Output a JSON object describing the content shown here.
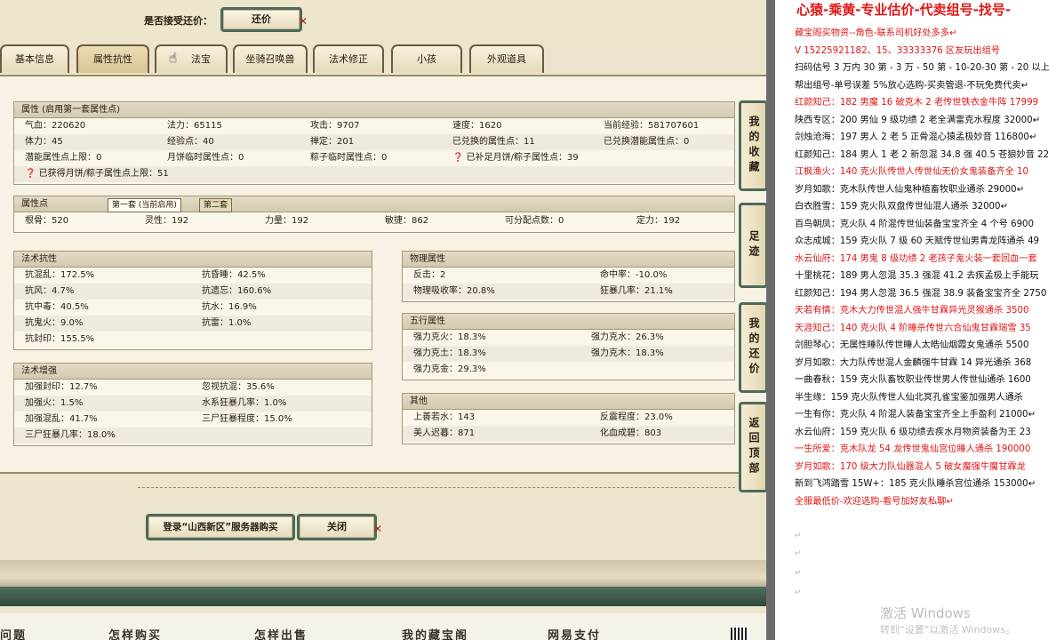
{
  "accept_counter": {
    "label": "是否接受还价：",
    "button": "还价"
  },
  "tabs": [
    "基本信息",
    "属性抗性",
    "法宝",
    "坐骑召唤兽",
    "法术修正",
    "小孩",
    "外观道具"
  ],
  "attr": {
    "header": "属性 (启用第一套属性点)",
    "rows": [
      [
        "气血：220620",
        "法力：65115",
        "攻击：9707",
        "速度：1620",
        "当前经验：581707601"
      ],
      [
        "体力：45",
        "经验点：40",
        "禅定：201",
        "已兑换的属性点：11",
        "已兑换潜能属性点：0"
      ],
      [
        "潜能属性点上限：0",
        "月饼临时属性点：0",
        "粽子临时属性点：0",
        "已补足月饼/粽子属性点：39",
        ""
      ],
      [
        "已获得月饼/粽子属性点上限：51",
        "",
        "",
        "",
        ""
      ]
    ]
  },
  "points": {
    "header": "属性点",
    "set1": "第一套 (当前启用)",
    "set2": "第二套",
    "row": [
      "根骨：520",
      "灵性：192",
      "力量：192",
      "敏捷：862",
      "可分配点数：0",
      "定力：192"
    ]
  },
  "resist": {
    "header": "法术抗性",
    "rows": [
      [
        "抗混乱：172.5%",
        "抗昏睡：42.5%"
      ],
      [
        "抗风：4.7%",
        "抗遗忘：160.6%"
      ],
      [
        "抗中毒：40.5%",
        "抗水：16.9%"
      ],
      [
        "抗鬼火：9.0%",
        "抗雷：1.0%"
      ],
      [
        "抗封印：155.5%",
        ""
      ]
    ]
  },
  "enhance": {
    "header": "法术增强",
    "rows": [
      [
        "加强封印：12.7%",
        "忽视抗混：35.6%"
      ],
      [
        "加强火：1.5%",
        "水系狂暴几率：1.0%"
      ],
      [
        "加强混乱：41.7%",
        "三尸狂暴程度：15.0%"
      ],
      [
        "三尸狂暴几率：18.0%",
        ""
      ]
    ]
  },
  "physical": {
    "header": "物理属性",
    "rows": [
      [
        "反击：2",
        "命中率：-10.0%"
      ],
      [
        "物理吸收率：20.8%",
        "狂暴几率：21.1%"
      ]
    ]
  },
  "elements": {
    "header": "五行属性",
    "rows": [
      [
        "强力克火：18.3%",
        "强力克水：26.3%"
      ],
      [
        "强力克土：18.3%",
        "强力克木：18.3%"
      ],
      [
        "强力克金：29.3%",
        ""
      ]
    ]
  },
  "other": {
    "header": "其他",
    "rows": [
      [
        "上善若水：143",
        "反震程度：23.0%"
      ],
      [
        "美人迟暮：871",
        "化血成碧：803"
      ]
    ]
  },
  "side_buttons": [
    "我的收藏",
    "足迹",
    "我的还价",
    "返回顶部"
  ],
  "bottom_buttons": {
    "buy": "登录“山西新区”服务器购买",
    "close": "关闭"
  },
  "footer_nav": [
    "问题",
    "怎样购买",
    "怎样出售",
    "我的藏宝阁",
    "网易支付"
  ],
  "notes": {
    "title": "心猿-乘黄-专业估价-代卖组号-找号-",
    "lines": [
      {
        "t": "藏宝阁买物资--角色-联系司机好处多多↵",
        "red": true
      },
      {
        "t": "V 15225921182、15、33333376  区友玩出组号",
        "red": true
      },
      {
        "t": "扫码估号 3 万内 30 第 - 3 万 - 50 第 - 10-20-30 第 - 20 以上",
        "red": false
      },
      {
        "t": "帮出组号-单号误差 5%放心选购-买卖管退-不玩免费代卖↵",
        "red": false
      },
      {
        "t": "红颜知己：182 男魔 16 破克木 2 老传世铁衣金牛阵 17999",
        "red": true
      },
      {
        "t": "陕西专区：200 男仙 9 级功绩 2 老全满雷克水程度 32000↵",
        "red": false
      },
      {
        "t": "剑烛沧海：197 男人 2 老 5 正骨混心猿孟极妙音 116800↵",
        "red": false
      },
      {
        "t": "红颜知己：184 男人 1 老 2 新忽混 34.8 强 40.5 苍狼妙音 22",
        "red": false
      },
      {
        "t": "江枫渔火：140 克火队传世人传世仙无价女鬼装备齐全 10",
        "red": true
      },
      {
        "t": "岁月如歌：克木队传世人仙鬼种植畜牧职业通杀 29000↵",
        "red": false
      },
      {
        "t": "白衣胜雪：159 克火队双盘传世仙混人通杀 32000↵",
        "red": false
      },
      {
        "t": "百鸟朝凤：克火队 4 阶混传世仙装备宝宝齐全 4 个号 6900",
        "red": false
      },
      {
        "t": "众志成城：159 克火队 7 级 60 天赋传世仙男青龙阵通杀 49",
        "red": false
      },
      {
        "t": "水云仙府：174 男鬼 8 级功绩 2 老孩子鬼火装一套回血一套",
        "red": true
      },
      {
        "t": "十里桃花：189 男人忽混 35.3 强混 41.2 去疾孟极上手能玩",
        "red": false
      },
      {
        "t": "红颜知己：194 男人忽混 36.5 强混 38.9 装备宝宝齐全 2750",
        "red": false
      },
      {
        "t": "天若有情：克木大力传世混人强牛甘霖异光灵猴通杀 3500",
        "red": true
      },
      {
        "t": "天涯知己：140 克火队 4 阶睡杀传世六合仙鬼甘霖瑞雪 35",
        "red": true
      },
      {
        "t": "剑胆琴心：无属性睡队传世睡人太皓仙烟霞女鬼通杀 5500",
        "red": false
      },
      {
        "t": "岁月如歌：大力队传世混人金麟强牛甘霖 14 异光通杀 368",
        "red": false
      },
      {
        "t": "一曲春秋：159 克火队畜牧职业传世男人传世仙通杀 1600",
        "red": false
      },
      {
        "t": "半生缘：159 克火队传世人仙北冥孔雀宝鉴加强男人通杀",
        "red": false
      },
      {
        "t": "一生有你：克火队 4 阶混人装备宝宝齐全上手盈利 21000↵",
        "red": false
      },
      {
        "t": "水云仙府：159 克火队 6 级功绩去疾水月物资装备为王 23",
        "red": false
      },
      {
        "t": "一生所爱：克木队龙 54 龙传世鬼仙宫位睡人通杀 190000",
        "red": true
      },
      {
        "t": "岁月如歌：170 级大力队仙器混人 5 破女魔强牛魔甘霖龙",
        "red": true
      },
      {
        "t": "新到飞鸿踏雪 15W+：185 克火队睡杀宫位通杀 153000↵",
        "red": false
      },
      {
        "t": "全服最低价-欢迎选购-看号加好友私聊↵",
        "red": true
      }
    ],
    "watermark1": "激活 Windows",
    "watermark2": "转到“设置”以激活 Windows。"
  },
  "colors": {
    "accent_red": "#e01616",
    "frame_green": "#4d6a5b",
    "panel_bg": "#f7f2e3"
  }
}
